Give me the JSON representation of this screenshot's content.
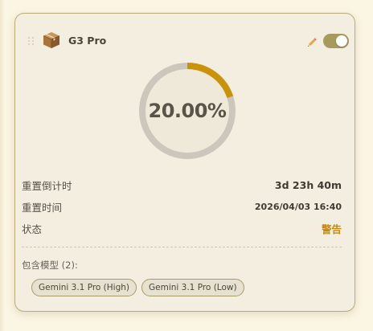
{
  "card": {
    "title": "G3 Pro",
    "icon": "package-box-icon",
    "enabled": true
  },
  "gauge": {
    "value_text": "20.00%",
    "fraction": 0.2,
    "colors": {
      "track": "#cbc7bd",
      "fill": "#c99207",
      "inner": "#efe9d9"
    }
  },
  "rows": [
    {
      "label": "重置倒计时",
      "value": "3d 23h 40m"
    },
    {
      "label": "重置时间",
      "value": "2026/04/03 16:40"
    },
    {
      "label": "状态",
      "value": "警告",
      "value_color": "#c58a0c"
    }
  ],
  "models": {
    "label": "包含模型 (2):",
    "items": [
      "Gemini 3.1 Pro (High)",
      "Gemini 3.1 Pro (Low)"
    ]
  },
  "colors": {
    "background": "#fbf5e3",
    "card": "#f3eedf",
    "card_border": "#b8ac7a",
    "toggle_on": "#a79a5c",
    "warning": "#c58a0c"
  }
}
